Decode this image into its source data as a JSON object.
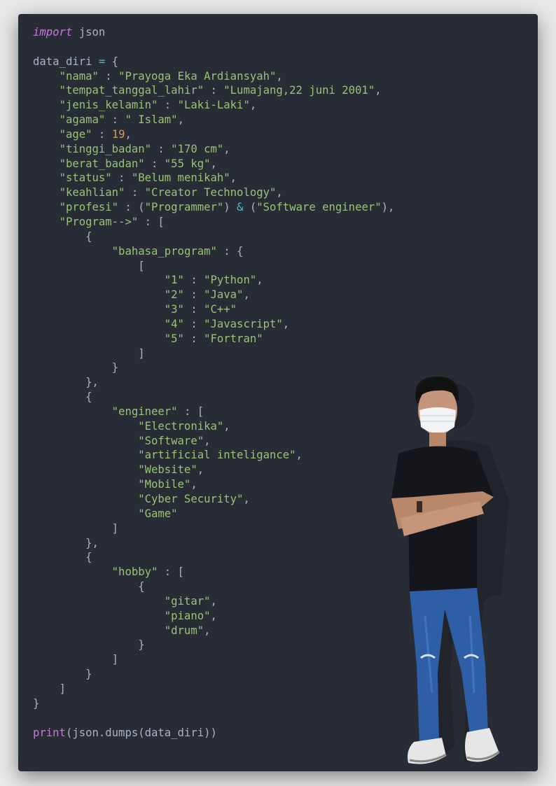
{
  "colors": {
    "background": "#282c34",
    "keyword": "#c678dd",
    "string": "#98c379",
    "number": "#d19a66",
    "operator": "#56b6c2",
    "text": "#abb2bf"
  },
  "code_lines": [
    [
      [
        "kw",
        "import"
      ],
      [
        "pn",
        " json"
      ]
    ],
    [],
    [
      [
        "pn",
        "data_diri "
      ],
      [
        "op",
        "="
      ],
      [
        "pn",
        " {"
      ]
    ],
    [
      [
        "pn",
        "    "
      ],
      [
        "str",
        "\"nama\""
      ],
      [
        "pn",
        " : "
      ],
      [
        "str",
        "\"Prayoga Eka Ardiansyah\""
      ],
      [
        "pn",
        ","
      ]
    ],
    [
      [
        "pn",
        "    "
      ],
      [
        "str",
        "\"tempat_tanggal_lahir\""
      ],
      [
        "pn",
        " : "
      ],
      [
        "str",
        "\"Lumajang,22 juni 2001\""
      ],
      [
        "pn",
        ","
      ]
    ],
    [
      [
        "pn",
        "    "
      ],
      [
        "str",
        "\"jenis_kelamin\""
      ],
      [
        "pn",
        " : "
      ],
      [
        "str",
        "\"Laki-Laki\""
      ],
      [
        "pn",
        ","
      ]
    ],
    [
      [
        "pn",
        "    "
      ],
      [
        "str",
        "\"agama\""
      ],
      [
        "pn",
        " : "
      ],
      [
        "str",
        "\" Islam\""
      ],
      [
        "pn",
        ","
      ]
    ],
    [
      [
        "pn",
        "    "
      ],
      [
        "str",
        "\"age\""
      ],
      [
        "pn",
        " : "
      ],
      [
        "num",
        "19"
      ],
      [
        "pn",
        ","
      ]
    ],
    [
      [
        "pn",
        "    "
      ],
      [
        "str",
        "\"tinggi_badan\""
      ],
      [
        "pn",
        " : "
      ],
      [
        "str",
        "\"170 cm\""
      ],
      [
        "pn",
        ","
      ]
    ],
    [
      [
        "pn",
        "    "
      ],
      [
        "str",
        "\"berat_badan\""
      ],
      [
        "pn",
        " : "
      ],
      [
        "str",
        "\"55 kg\""
      ],
      [
        "pn",
        ","
      ]
    ],
    [
      [
        "pn",
        "    "
      ],
      [
        "str",
        "\"status\""
      ],
      [
        "pn",
        " : "
      ],
      [
        "str",
        "\"Belum menikah\""
      ],
      [
        "pn",
        ","
      ]
    ],
    [
      [
        "pn",
        "    "
      ],
      [
        "str",
        "\"keahlian\""
      ],
      [
        "pn",
        " : "
      ],
      [
        "str",
        "\"Creator Technology\""
      ],
      [
        "pn",
        ","
      ]
    ],
    [
      [
        "pn",
        "    "
      ],
      [
        "str",
        "\"profesi\""
      ],
      [
        "pn",
        " : ("
      ],
      [
        "str",
        "\"Programmer\""
      ],
      [
        "pn",
        ") "
      ],
      [
        "op",
        "&"
      ],
      [
        "pn",
        " ("
      ],
      [
        "str",
        "\"Software engineer\""
      ],
      [
        "pn",
        "),"
      ]
    ],
    [
      [
        "pn",
        "    "
      ],
      [
        "str",
        "\"Program-->\""
      ],
      [
        "pn",
        " : ["
      ]
    ],
    [
      [
        "pn",
        "        {"
      ]
    ],
    [
      [
        "pn",
        "            "
      ],
      [
        "str",
        "\"bahasa_program\""
      ],
      [
        "pn",
        " : {"
      ]
    ],
    [
      [
        "pn",
        "                ["
      ]
    ],
    [
      [
        "pn",
        "                    "
      ],
      [
        "str",
        "\"1\""
      ],
      [
        "pn",
        " : "
      ],
      [
        "str",
        "\"Python\""
      ],
      [
        "pn",
        ","
      ]
    ],
    [
      [
        "pn",
        "                    "
      ],
      [
        "str",
        "\"2\""
      ],
      [
        "pn",
        " : "
      ],
      [
        "str",
        "\"Java\""
      ],
      [
        "pn",
        ","
      ]
    ],
    [
      [
        "pn",
        "                    "
      ],
      [
        "str",
        "\"3\""
      ],
      [
        "pn",
        " : "
      ],
      [
        "str",
        "\"C++\""
      ]
    ],
    [
      [
        "pn",
        "                    "
      ],
      [
        "str",
        "\"4\""
      ],
      [
        "pn",
        " : "
      ],
      [
        "str",
        "\"Javascript\""
      ],
      [
        "pn",
        ","
      ]
    ],
    [
      [
        "pn",
        "                    "
      ],
      [
        "str",
        "\"5\""
      ],
      [
        "pn",
        " : "
      ],
      [
        "str",
        "\"Fortran\""
      ]
    ],
    [
      [
        "pn",
        "                ]"
      ]
    ],
    [
      [
        "pn",
        "            }"
      ]
    ],
    [
      [
        "pn",
        "        },"
      ]
    ],
    [
      [
        "pn",
        "        {"
      ]
    ],
    [
      [
        "pn",
        "            "
      ],
      [
        "str",
        "\"engineer\""
      ],
      [
        "pn",
        " : ["
      ]
    ],
    [
      [
        "pn",
        "                "
      ],
      [
        "str",
        "\"Electronika\""
      ],
      [
        "pn",
        ","
      ]
    ],
    [
      [
        "pn",
        "                "
      ],
      [
        "str",
        "\"Software\""
      ],
      [
        "pn",
        ","
      ]
    ],
    [
      [
        "pn",
        "                "
      ],
      [
        "str",
        "\"artificial inteligance\""
      ],
      [
        "pn",
        ","
      ]
    ],
    [
      [
        "pn",
        "                "
      ],
      [
        "str",
        "\"Website\""
      ],
      [
        "pn",
        ","
      ]
    ],
    [
      [
        "pn",
        "                "
      ],
      [
        "str",
        "\"Mobile\""
      ],
      [
        "pn",
        ","
      ]
    ],
    [
      [
        "pn",
        "                "
      ],
      [
        "str",
        "\"Cyber Security\""
      ],
      [
        "pn",
        ","
      ]
    ],
    [
      [
        "pn",
        "                "
      ],
      [
        "str",
        "\"Game\""
      ]
    ],
    [
      [
        "pn",
        "            ]"
      ]
    ],
    [
      [
        "pn",
        "        },"
      ]
    ],
    [
      [
        "pn",
        "        {"
      ]
    ],
    [
      [
        "pn",
        "            "
      ],
      [
        "str",
        "\"hobby\""
      ],
      [
        "pn",
        " : ["
      ]
    ],
    [
      [
        "pn",
        "                {"
      ]
    ],
    [
      [
        "pn",
        "                    "
      ],
      [
        "str",
        "\"gitar\""
      ],
      [
        "pn",
        ","
      ]
    ],
    [
      [
        "pn",
        "                    "
      ],
      [
        "str",
        "\"piano\""
      ],
      [
        "pn",
        ","
      ]
    ],
    [
      [
        "pn",
        "                    "
      ],
      [
        "str",
        "\"drum\""
      ],
      [
        "pn",
        ","
      ]
    ],
    [
      [
        "pn",
        "                }"
      ]
    ],
    [
      [
        "pn",
        "            ]"
      ]
    ],
    [
      [
        "pn",
        "        }"
      ]
    ],
    [
      [
        "pn",
        "    ]"
      ]
    ],
    [
      [
        "pn",
        "}"
      ]
    ],
    [],
    [
      [
        "fn",
        "print"
      ],
      [
        "pn",
        "(json.dumps(data_diri))"
      ]
    ]
  ]
}
